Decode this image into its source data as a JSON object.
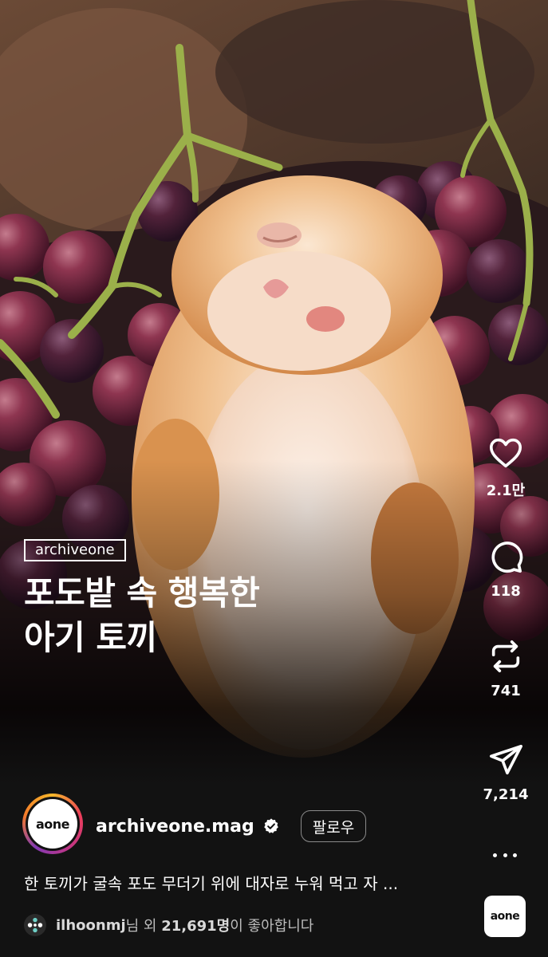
{
  "post": {
    "source_tag": "archiveone",
    "headline_line1": "포도밭 속 행복한",
    "headline_line2": "아기 토끼"
  },
  "actions": {
    "likes_count": "2.1만",
    "comments_count": "118",
    "reposts_count": "741",
    "shares_count": "7,214"
  },
  "account": {
    "avatar_text": "aone",
    "username": "archiveone.mag",
    "follow_label": "팔로우"
  },
  "caption": "한 토끼가 굴속 포도 무더기 위에 대자로 누워 먹고 자 ...",
  "liked_by": {
    "user": "ilhoonmj",
    "middle": "님 외 ",
    "count": "21,691명",
    "suffix": "이 좋아합니다"
  },
  "audio_thumb_text": "aone",
  "colors": {
    "background": "#121212",
    "grape": "#6e2438",
    "fur": "#e9a862",
    "stem": "#9bb04a"
  },
  "icons": [
    "heart-icon",
    "comment-icon",
    "repost-icon",
    "send-icon",
    "more-icon",
    "verified-badge-icon"
  ]
}
